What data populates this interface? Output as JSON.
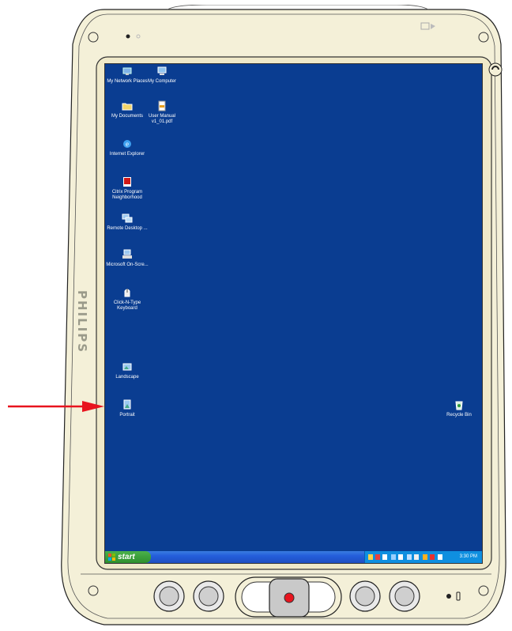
{
  "device": {
    "brand": "PHILIPS"
  },
  "desktop": {
    "icons": [
      {
        "label": "My Network Places",
        "icon": "network-places-icon"
      },
      {
        "label": "My Computer",
        "icon": "computer-icon"
      },
      {
        "label": "My Documents",
        "icon": "documents-folder-icon"
      },
      {
        "label": "User Manual v1_01.pdf",
        "icon": "pdf-document-icon"
      },
      {
        "label": "Internet Explorer",
        "icon": "internet-explorer-icon"
      },
      {
        "label": "Citrix Program Neighborhood",
        "icon": "citrix-icon"
      },
      {
        "label": "Remote Desktop ...",
        "icon": "remote-desktop-icon"
      },
      {
        "label": "Microsoft On-Scre...",
        "icon": "on-screen-keyboard-icon"
      },
      {
        "label": "Click-N-Type Keyboard",
        "icon": "keyboard-icon"
      },
      {
        "label": "Landscape",
        "icon": "landscape-icon"
      },
      {
        "label": "Portrait",
        "icon": "portrait-icon"
      },
      {
        "label": "Recycle Bin",
        "icon": "recycle-bin-icon"
      }
    ]
  },
  "taskbar": {
    "start_label": "start",
    "clock": "3:30 PM"
  },
  "colors": {
    "desktop_bg": "#0a3d91",
    "bezel": "#f3efd6",
    "annotation_arrow": "#e8141e",
    "power_button": "#e8141e"
  }
}
